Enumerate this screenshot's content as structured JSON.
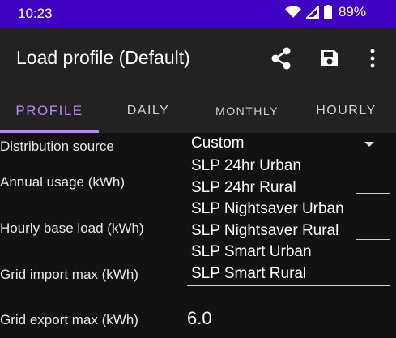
{
  "status": {
    "time": "10:23",
    "battery": "89%"
  },
  "appbar": {
    "title": "Load profile (Default)"
  },
  "tabs": [
    "PROFILE",
    "DAILY",
    "MONTHLY",
    "HOURLY"
  ],
  "fields": {
    "distribution_source": "Distribution source",
    "annual_usage": "Annual usage (kWh)",
    "hourly_base_load": "Hourly base load (kWh)",
    "grid_import_max": "Grid import max (kWh)",
    "grid_export_max": "Grid export max (kWh)",
    "grid_export_value": "6.0"
  },
  "dropdown": {
    "selected": "Custom",
    "options": [
      "SLP 24hr Urban",
      "SLP 24hr Rural",
      "SLP Nightsaver Urban",
      "SLP Nightsaver Rural",
      "SLP Smart Urban",
      "SLP Smart Rural"
    ]
  },
  "colors": {
    "status_bar": "#3e00c2",
    "accent": "#bb86fc",
    "toolbar": "#222222",
    "background": "#121212"
  }
}
